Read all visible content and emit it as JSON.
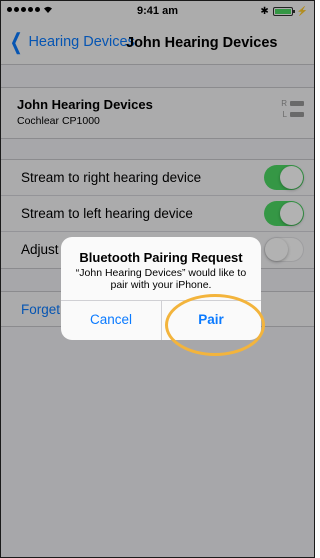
{
  "status_bar": {
    "time": "9:41 am",
    "bluetooth_symbol": "✱",
    "bolt_symbol": "⚡"
  },
  "nav": {
    "back_label": "Hearing Devices",
    "title": "John Hearing Devices"
  },
  "device": {
    "name": "John Hearing Devices",
    "model": "Cochlear CP1000",
    "right_label": "R",
    "left_label": "L"
  },
  "settings": {
    "rows": [
      {
        "label": "Stream to right hearing device",
        "toggle": "on"
      },
      {
        "label": "Stream to left hearing device",
        "toggle": "on"
      },
      {
        "label": "Adjust",
        "toggle": "off"
      }
    ]
  },
  "forget": {
    "label": "Forget"
  },
  "alert": {
    "title": "Bluetooth Pairing Request",
    "message": "“John Hearing Devices” would like to pair with your iPhone.",
    "cancel_label": "Cancel",
    "pair_label": "Pair"
  },
  "colors": {
    "accent": "#0a7aff",
    "toggle_on": "#4cd964",
    "highlight": "#f3b43c"
  },
  "icons": [
    "signal-icon",
    "wifi-icon",
    "bluetooth-icon",
    "battery-icon",
    "chevron-left-icon"
  ]
}
